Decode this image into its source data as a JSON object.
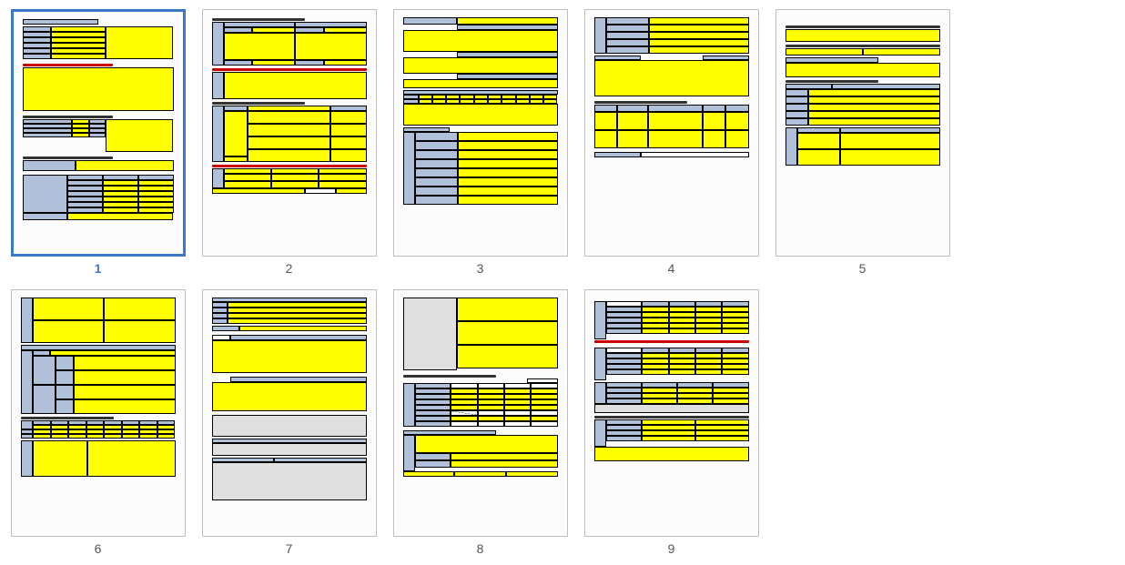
{
  "pages": [
    {
      "number": "1",
      "selected": true
    },
    {
      "number": "2",
      "selected": false
    },
    {
      "number": "3",
      "selected": false
    },
    {
      "number": "4",
      "selected": false
    },
    {
      "number": "5",
      "selected": false
    },
    {
      "number": "6",
      "selected": false
    },
    {
      "number": "7",
      "selected": false
    },
    {
      "number": "8",
      "selected": false
    },
    {
      "number": "9",
      "selected": false
    }
  ]
}
